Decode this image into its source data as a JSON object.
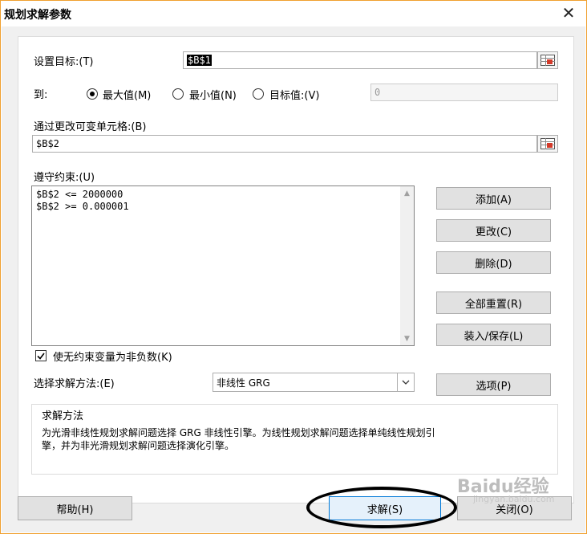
{
  "window": {
    "title": "规划求解参数",
    "close_glyph": "✕"
  },
  "objective": {
    "label": "设置目标:(T)",
    "value": "$B$1"
  },
  "to": {
    "label": "到:",
    "options": [
      {
        "label": "最大值(M)",
        "checked": true
      },
      {
        "label": "最小值(N)",
        "checked": false
      },
      {
        "label": "目标值:(V)",
        "checked": false
      }
    ],
    "value_of": "0"
  },
  "changing_cells": {
    "label": "通过更改可变单元格:(B)",
    "value": "$B$2"
  },
  "constraints": {
    "label": "遵守约束:(U)",
    "items": [
      "$B$2 <= 2000000",
      "$B$2 >= 0.000001"
    ]
  },
  "buttons": {
    "add": "添加(A)",
    "change": "更改(C)",
    "delete": "删除(D)",
    "reset_all": "全部重置(R)",
    "load_save": "装入/保存(L)",
    "options": "选项(P)",
    "help": "帮助(H)",
    "solve": "求解(S)",
    "close": "关闭(O)"
  },
  "nonnegative": {
    "label": "使无约束变量为非负数(K)",
    "checked": true
  },
  "solving_method": {
    "label": "选择求解方法:(E)",
    "value": "非线性 GRG"
  },
  "method_box": {
    "title": "求解方法",
    "description_line1": "为光滑非线性规划求解问题选择 GRG 非线性引擎。为线性规划求解问题选择单纯线性规划引",
    "description_line2": "擎，并为非光滑规划求解问题选择演化引擎。"
  },
  "watermark": {
    "main": "Baidu经验",
    "sub": "jingyan.baidu.com"
  },
  "colors": {
    "accent_border": "#f0a030",
    "button_face": "#e1e1e1",
    "panel_bg": "#f0f0f0"
  }
}
